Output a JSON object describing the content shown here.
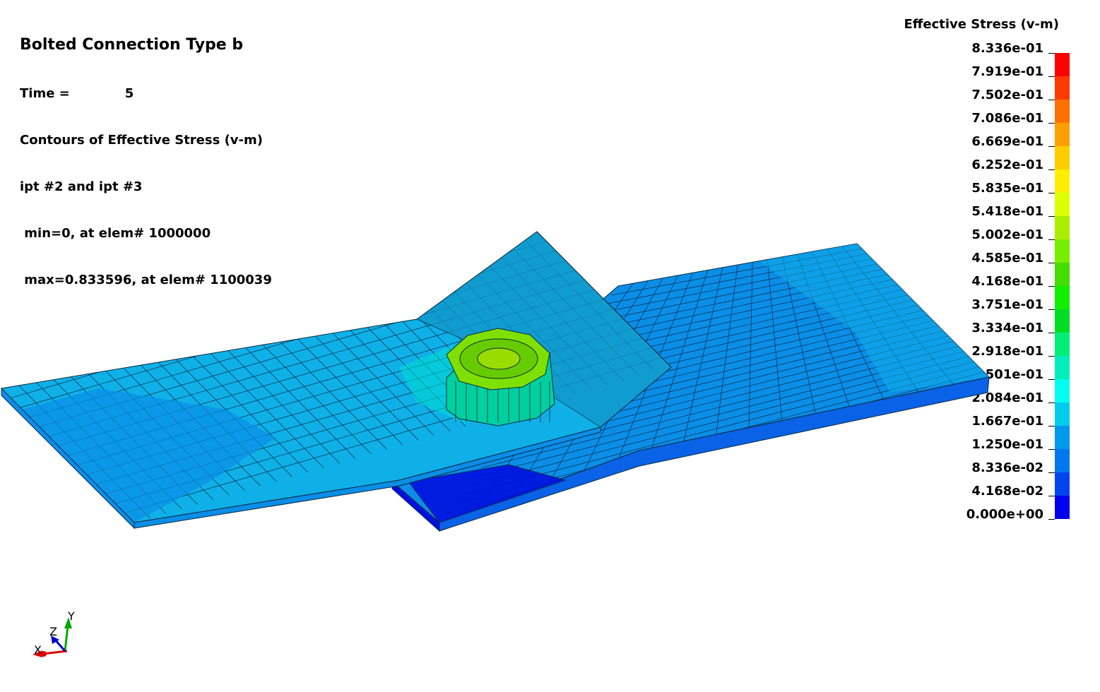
{
  "header": {
    "title": "Bolted Connection Type b",
    "time_label": "Time =",
    "time_value": "5",
    "contour_line": "Contours of Effective Stress (v-m)",
    "ipt_line": "ipt #2 and ipt #3",
    "min_line": " min=0, at elem# 1000000",
    "max_line": " max=0.833596, at elem# 1100039"
  },
  "legend": {
    "title": "Effective Stress (v-m)",
    "labels": [
      "8.336e-01",
      "7.919e-01",
      "7.502e-01",
      "7.086e-01",
      "6.669e-01",
      "6.252e-01",
      "5.835e-01",
      "5.418e-01",
      "5.002e-01",
      "4.585e-01",
      "4.168e-01",
      "3.751e-01",
      "3.334e-01",
      "2.918e-01",
      "2.501e-01",
      "2.084e-01",
      "1.667e-01",
      "1.250e-01",
      "8.336e-02",
      "4.168e-02",
      "0.000e+00"
    ],
    "colors": [
      "#ff0000",
      "#ff3a00",
      "#ff7000",
      "#ffa000",
      "#ffcc00",
      "#ffee00",
      "#ddff00",
      "#aaee00",
      "#77ee00",
      "#44dd00",
      "#11ee00",
      "#00dd22",
      "#00ee77",
      "#00eebb",
      "#00ffee",
      "#00ccee",
      "#0099ee",
      "#0077ee",
      "#0044ee",
      "#0000ee"
    ]
  },
  "triad": {
    "x": "X",
    "y": "Y",
    "z": "Z"
  },
  "colors": {
    "plate_light": "#0fb0e8",
    "plate_mid": "#0a8ee8",
    "plate_dark": "#0a62e6",
    "plate_deep": "#0010e0",
    "bolt_green": "#66dd00",
    "bolt_teal": "#00e0b0",
    "mesh_line": "#0a2a40"
  }
}
